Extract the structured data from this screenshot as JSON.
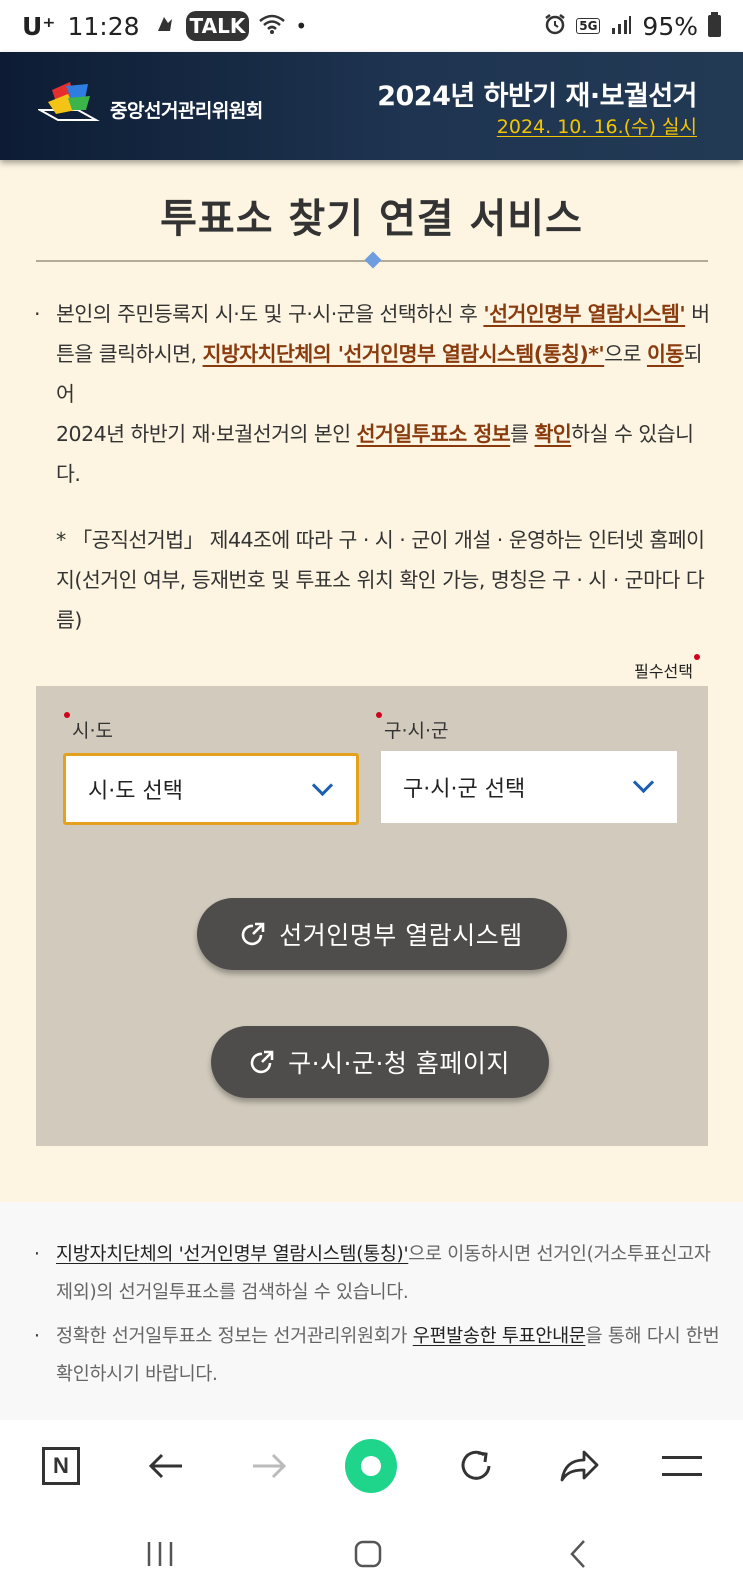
{
  "status_bar": {
    "carrier": "U⁺",
    "time": "11:28",
    "talk": "TALK",
    "network": "5G",
    "battery": "95%"
  },
  "header": {
    "org_name": "중앙선거관리위원회",
    "election_title": "2024년 하반기 재·보궐선거",
    "election_date": "2024. 10. 16.(수) 실시"
  },
  "page": {
    "title": "투표소 찾기 연결 서비스",
    "bullet": "·",
    "desc": {
      "p1": "본인의 주민등록지 시·도 및 구·시·군을 선택하신 후 ",
      "h1": "'선거인명부 열람시스템'",
      "p2": " 버튼을 클릭하시면, ",
      "h2": "지방자치단체의 '선거인명부 열람시스템(통칭)*'",
      "p3": "으로 ",
      "h3": "이동",
      "p4": "되어",
      "p5": "2024년 하반기 재·보궐선거의 본인 ",
      "h4": "선거일투표소 정보",
      "p6": "를 ",
      "h5": "확인",
      "p7": "하실 수 있습니다."
    },
    "note": "* 「공직선거법」 제44조에 따라 구 · 시 · 군이 개설 · 운영하는 인터넷 홈페이지(선거인 여부, 등재번호 및 투표소 위치 확인 가능, 명칭은 구 · 시 · 군마다 다름)",
    "required_label": "필수선택"
  },
  "form": {
    "sido_label": "시·도",
    "sido_value": "시·도 선택",
    "sigungu_label": "구·시·군",
    "sigungu_value": "구·시·군 선택",
    "btn_voter_list": "선거인명부 열람시스템",
    "btn_homepage": "구·시·군·청 홈페이지"
  },
  "info": {
    "item1_link": "지방자치단체의 '선거인명부 열람시스템(통칭)'",
    "item1_text": "으로 이동하시면 선거인(거소투표신고자 제외)의 선거일투표소를 검색하실 수 있습니다.",
    "item2_pre": "정확한 선거일투표소 정보는 선거관리위원회가 ",
    "item2_link": "우편발송한 투표안내문",
    "item2_post": "을 통해 다시 한번 확인하시기 바랍니다."
  },
  "browser": {
    "n_label": "N"
  },
  "colors": {
    "header_bg": "#0d1c34",
    "accent_yellow": "#f4c500",
    "highlight_brown": "#8a3b0e",
    "panel_gray": "#d2cbbd",
    "button_dark": "#4e4d4b",
    "page_bg": "#fdf5e2",
    "green": "#1fd58b"
  },
  "icons": [
    "wifi-icon",
    "alarm-icon",
    "signal-icon",
    "battery-icon",
    "external-link-icon",
    "back-icon",
    "forward-icon",
    "reload-icon",
    "share-icon",
    "menu-icon",
    "recents-icon",
    "home-icon"
  ]
}
